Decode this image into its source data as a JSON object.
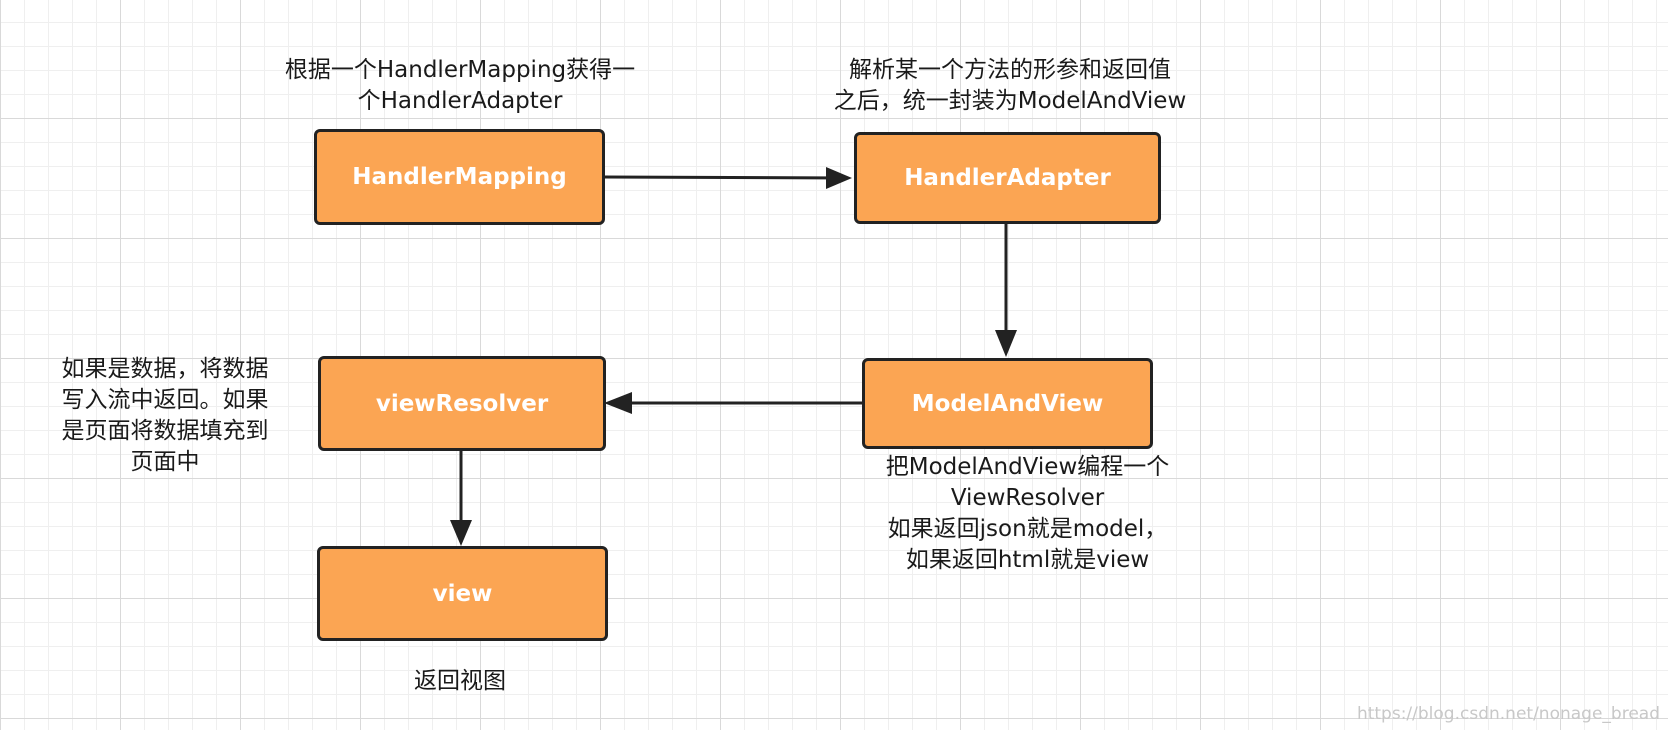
{
  "diagram": {
    "nodes": {
      "handler_mapping": "HandlerMapping",
      "handler_adapter": "HandlerAdapter",
      "model_and_view": "ModelAndView",
      "view_resolver": "viewResolver",
      "view": "view"
    },
    "notes": {
      "handler_mapping": [
        "根据一个HandlerMapping获得一",
        "个HandlerAdapter"
      ],
      "handler_adapter": [
        "解析某一个方法的形参和返回值",
        "之后，统一封装为ModelAndView"
      ],
      "model_and_view": [
        "把ModelAndView编程一个",
        "ViewResolver",
        "如果返回json就是model，",
        "如果返回html就是view"
      ],
      "view_resolver": [
        "如果是数据，将数据",
        "写入流中返回。如果",
        "是页面将数据填充到",
        "页面中"
      ],
      "view": [
        "返回视图"
      ]
    },
    "colors": {
      "node_fill": "#fba553",
      "node_border": "#222222",
      "arrow": "#222222"
    }
  },
  "watermark": "https://blog.csdn.net/nonage_bread"
}
